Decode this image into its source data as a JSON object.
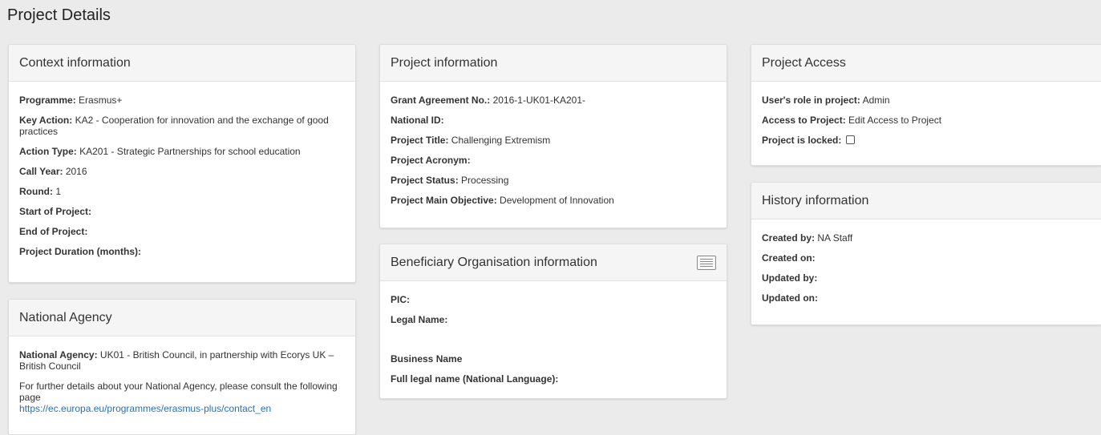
{
  "page_title": "Project Details",
  "context": {
    "title": "Context information",
    "programme_label": "Programme:",
    "programme_value": " Erasmus+",
    "key_action_label": "Key Action:",
    "key_action_value": " KA2 - Cooperation for innovation and the exchange of good practices",
    "action_type_label": "Action Type:",
    "action_type_value": " KA201 - Strategic Partnerships for school education",
    "call_year_label": "Call Year:",
    "call_year_value": " 2016",
    "round_label": "Round:",
    "round_value": " 1",
    "start_label": "Start of Project:",
    "start_value": "",
    "end_label": "End of Project:",
    "end_value": "",
    "duration_label": "Project Duration (months):",
    "duration_value": ""
  },
  "national_agency": {
    "title": "National Agency",
    "agency_label": "National Agency:",
    "agency_value": " UK01 - British Council, in partnership with Ecorys UK – British Council",
    "details_text": "For further details about your National Agency, please consult the following page",
    "link": "https://ec.europa.eu/programmes/erasmus-plus/contact_en"
  },
  "project_info": {
    "title": "Project information",
    "grant_label": "Grant Agreement No.:",
    "grant_value": " 2016-1-UK01-KA201-",
    "national_id_label": "National ID:",
    "national_id_value": "",
    "project_title_label": "Project Title:",
    "project_title_value": " Challenging Extremism",
    "acronym_label": "Project Acronym:",
    "acronym_value": "",
    "status_label": "Project Status:",
    "status_value": " Processing",
    "objective_label": "Project Main Objective:",
    "objective_value": " Development of Innovation"
  },
  "beneficiary": {
    "title": "Beneficiary Organisation information",
    "icon": "list-icon",
    "pic_label": "PIC:",
    "legal_name_label": "Legal Name:",
    "business_name_label": "Business Name",
    "full_legal_label": "Full legal name (National Language):"
  },
  "access": {
    "title": "Project Access",
    "role_label": "User's role in project:",
    "role_value": " Admin",
    "access_label": "Access to Project:",
    "access_value": " Edit Access to Project",
    "locked_label": "Project is locked:",
    "locked": false
  },
  "history": {
    "title": "History information",
    "created_by_label": "Created by:",
    "created_by_value": " NA Staff",
    "created_on_label": "Created on:",
    "updated_by_label": "Updated by:",
    "updated_on_label": "Updated on:"
  }
}
